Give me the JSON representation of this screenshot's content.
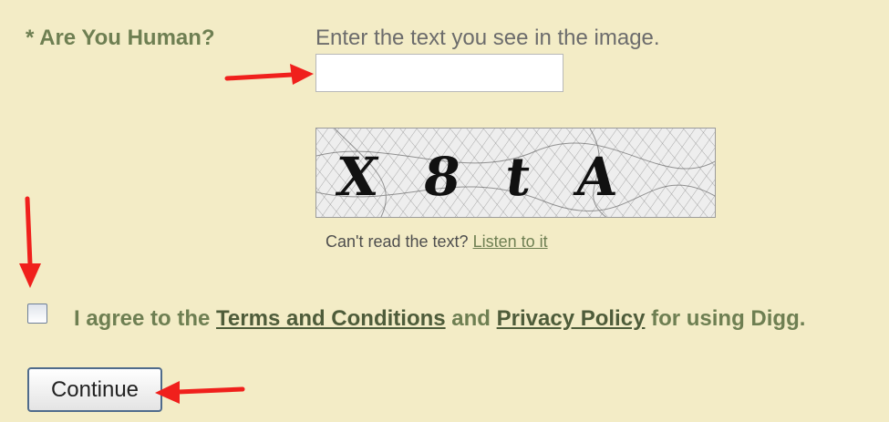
{
  "form": {
    "human_label": "* Are You Human?",
    "instruction": "Enter the text you see in the image.",
    "captcha_input_value": "",
    "captcha_text": "X8tA",
    "cant_read": "Can't read the text?",
    "listen_link": "Listen to it",
    "agree_prefix": "I agree to the",
    "terms_link": "Terms and Conditions",
    "agree_and": "and",
    "privacy_link": "Privacy Policy",
    "agree_suffix": "for using Digg.",
    "continue_label": "Continue"
  },
  "colors": {
    "panel_bg": "#f3ecc6",
    "label_green": "#6e7f52",
    "annotation_arrow": "#f0201c"
  },
  "annotations": {
    "arrow_icon": "red-arrow-icon"
  }
}
